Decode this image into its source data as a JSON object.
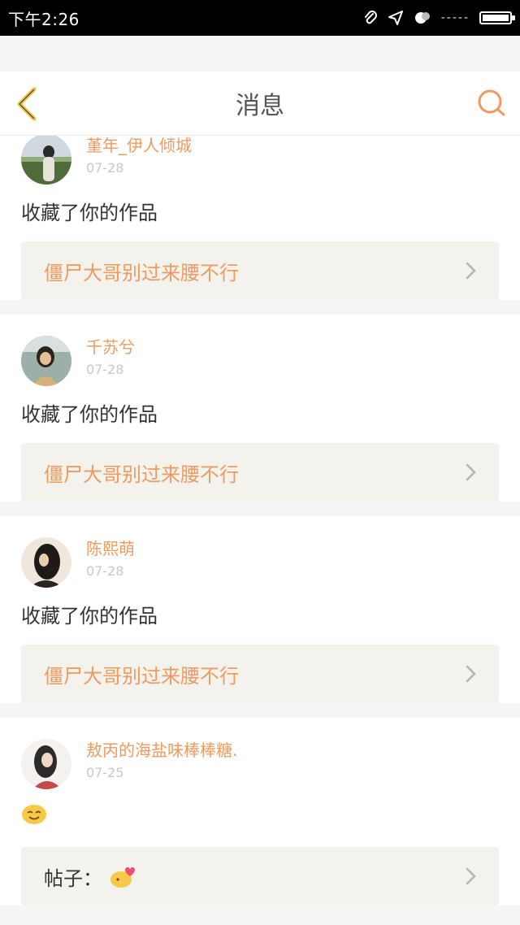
{
  "status": {
    "time": "下午2:26",
    "signal": "-----"
  },
  "header": {
    "title": "消息"
  },
  "colors": {
    "accent": "#ef9b60",
    "back": "#f2c23a",
    "card_bg": "#f3f2ec"
  },
  "messages": [
    {
      "user": "堇年_伊人倾城",
      "date": "07-28",
      "action": "收藏了你的作品",
      "work": "僵尸大哥别过来腰不行"
    },
    {
      "user": "千苏兮",
      "date": "07-28",
      "action": "收藏了你的作品",
      "work": "僵尸大哥别过来腰不行"
    },
    {
      "user": "陈熙萌",
      "date": "07-28",
      "action": "收藏了你的作品",
      "work": "僵尸大哥别过来腰不行"
    },
    {
      "user": "敖丙的海盐味棒棒糖.",
      "date": "07-25",
      "action_icon": "smile-emoji",
      "work_prefix": "帖子：",
      "work_icon": "kiss-emoji"
    }
  ]
}
